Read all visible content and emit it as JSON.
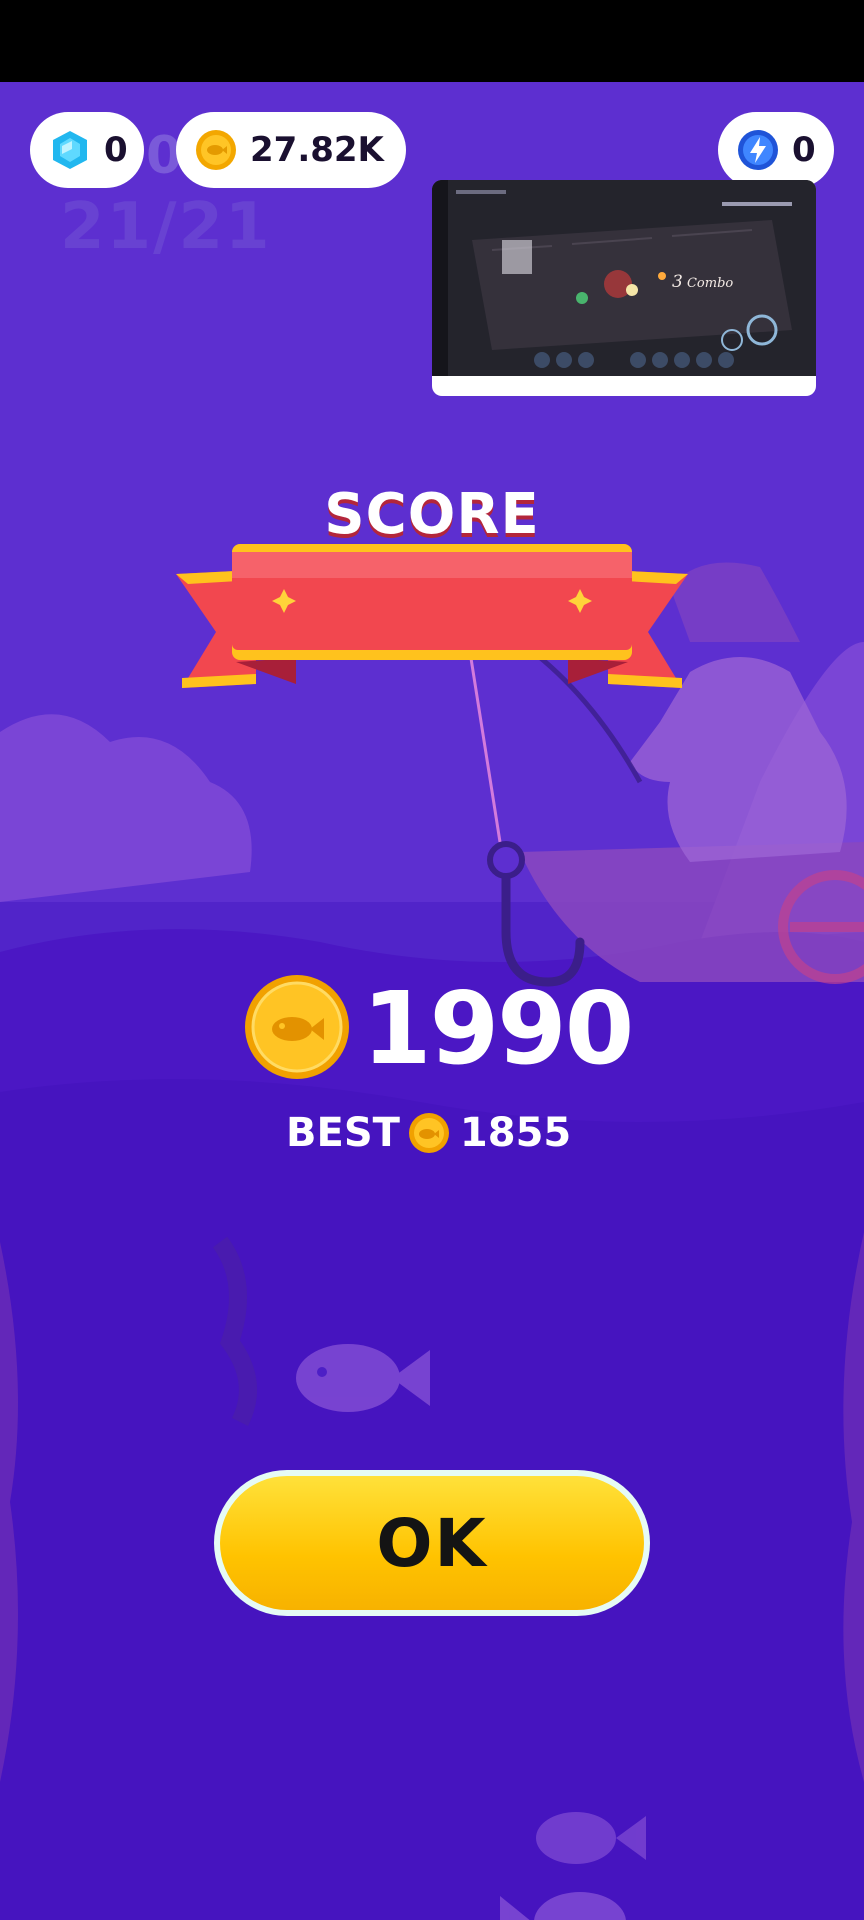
{
  "hud": {
    "gems": "0",
    "coins": "27.82K",
    "energy": "0",
    "ghost_counter": "21/21",
    "ghost_zero": "0"
  },
  "video_overlay": {
    "combo_value": "3",
    "combo_label": "Combo"
  },
  "result": {
    "banner_title": "SCORE",
    "score": "1990",
    "best_label": "BEST",
    "best_value": "1855"
  },
  "actions": {
    "ok_label": "OK"
  },
  "icons": [
    "gem-icon",
    "coin-icon",
    "energy-icon",
    "fish-coin-icon"
  ],
  "colors": {
    "background": "#5124c9",
    "ribbon_red": "#f2474f",
    "ribbon_gold": "#ffc21d",
    "button_yellow": "#ffcf1a",
    "coin_gold": "#f7b500"
  }
}
